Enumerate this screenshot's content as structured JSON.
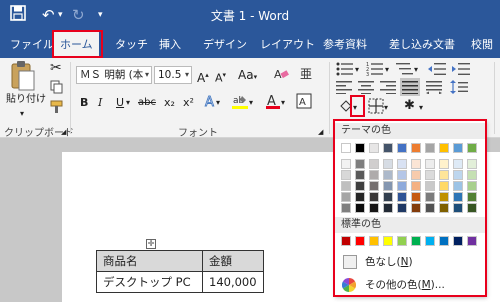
{
  "window": {
    "title": "文書 1 - Word"
  },
  "tabs": [
    "ファイル",
    "ホーム",
    "タッチ",
    "挿入",
    "デザイン",
    "レイアウト",
    "参考資料",
    "差し込み文書",
    "校閲"
  ],
  "clipboard": {
    "paste_label": "貼り付け",
    "group_label": "クリップボード"
  },
  "font": {
    "font_name": "ＭＳ 明朝 (本",
    "font_size": "10.5",
    "group_label": "フォント",
    "format_buttons": [
      "B",
      "I",
      "U",
      "abc",
      "x₂",
      "x²"
    ]
  },
  "shading_menu": {
    "theme_header": "テーマの色",
    "standard_header": "標準の色",
    "no_color_label": "色なし(",
    "no_color_key": "N",
    "more_colors_label": "その他の色(",
    "more_colors_key": "M",
    "more_colors_suffix": ")...",
    "theme_top": [
      "#ffffff",
      "#000000",
      "#e7e6e6",
      "#44546a",
      "#4472c4",
      "#ed7d31",
      "#a5a5a5",
      "#ffc000",
      "#5b9bd5",
      "#70ad47"
    ],
    "theme_shades": [
      [
        "#f2f2f2",
        "#7f7f7f",
        "#d0cece",
        "#d6dce4",
        "#d9e2f3",
        "#fbe5d5",
        "#ededed",
        "#fff2cc",
        "#deeaf6",
        "#e2efd9"
      ],
      [
        "#d8d8d8",
        "#595959",
        "#aeabab",
        "#adb9ca",
        "#b4c6e7",
        "#f7cbac",
        "#dbdbdb",
        "#fee599",
        "#bdd6ee",
        "#c5e0b3"
      ],
      [
        "#bfbfbf",
        "#3f3f3f",
        "#757070",
        "#8496b0",
        "#8eaadb",
        "#f4b183",
        "#c9c9c9",
        "#ffd965",
        "#9cc3e5",
        "#a8d08d"
      ],
      [
        "#a5a5a5",
        "#262626",
        "#3a3838",
        "#323f4f",
        "#2f5496",
        "#c55a11",
        "#7b7b7b",
        "#bf9000",
        "#2e75b5",
        "#538135"
      ],
      [
        "#7f7f7f",
        "#0c0c0c",
        "#171616",
        "#222a35",
        "#1f3864",
        "#833c0b",
        "#525252",
        "#7f6000",
        "#1e4e79",
        "#375623"
      ]
    ],
    "standard": [
      "#c00000",
      "#ff0000",
      "#ffc000",
      "#ffff00",
      "#92d050",
      "#00b050",
      "#00b0f0",
      "#0070c0",
      "#002060",
      "#7030a0"
    ]
  },
  "document": {
    "table": [
      [
        "商品名",
        "金額"
      ],
      [
        "デスクトップ PC",
        "140,000"
      ]
    ]
  },
  "highlight_color": "#e8001c"
}
